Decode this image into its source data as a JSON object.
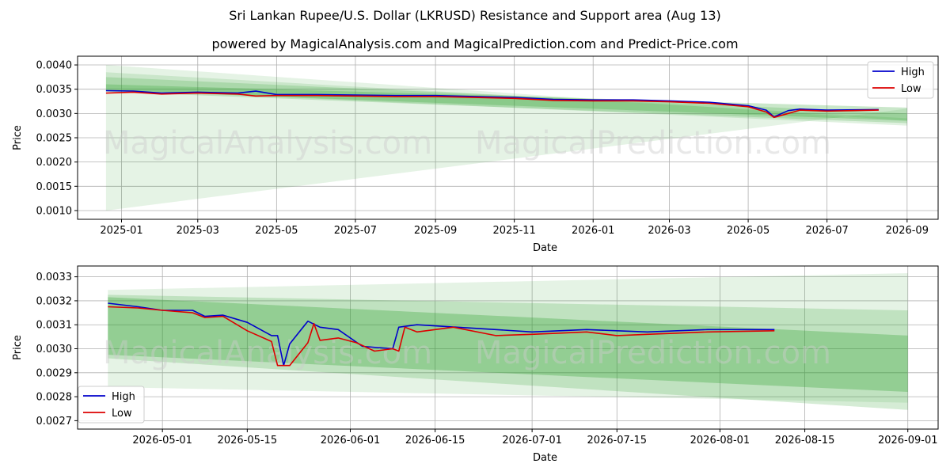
{
  "header": {
    "title": "Sri Lankan Rupee/U.S. Dollar (LKRUSD) Resistance and Support area (Aug 13)",
    "subtitle": "powered by MagicalAnalysis.com and MagicalPrediction.com and Predict-Price.com"
  },
  "watermarks": [
    "MagicalAnalysis.com",
    "MagicalPrediction.com"
  ],
  "colors": {
    "high": "#0000cc",
    "low": "#dd0000",
    "band": "#2ca02c"
  },
  "chart_data": [
    {
      "type": "line",
      "xlabel": "Date",
      "ylabel": "Price",
      "x_ticks": [
        "2025-01",
        "2025-03",
        "2025-05",
        "2025-07",
        "2025-09",
        "2025-11",
        "2026-01",
        "2026-03",
        "2026-05",
        "2026-07",
        "2026-09"
      ],
      "y_ticks": [
        "0.0010",
        "0.0015",
        "0.0020",
        "0.0025",
        "0.0030",
        "0.0035",
        "0.0040"
      ],
      "legend": [
        "High",
        "Low"
      ],
      "legend_position": "top-right",
      "grid": true,
      "series": [
        {
          "name": "High",
          "points": [
            [
              "2024-12-20",
              0.00347
            ],
            [
              "2025-01-10",
              0.00346
            ],
            [
              "2025-02-01",
              0.00342
            ],
            [
              "2025-03-01",
              0.00344
            ],
            [
              "2025-04-01",
              0.00342
            ],
            [
              "2025-04-15",
              0.00346
            ],
            [
              "2025-05-01",
              0.00339
            ],
            [
              "2025-06-01",
              0.00339
            ],
            [
              "2025-07-01",
              0.00338
            ],
            [
              "2025-08-01",
              0.00337
            ],
            [
              "2025-09-01",
              0.00337
            ],
            [
              "2025-10-01",
              0.00335
            ],
            [
              "2025-11-01",
              0.00333
            ],
            [
              "2025-12-01",
              0.00329
            ],
            [
              "2026-01-01",
              0.00328
            ],
            [
              "2026-02-01",
              0.00328
            ],
            [
              "2026-03-01",
              0.00326
            ],
            [
              "2026-04-01",
              0.00323
            ],
            [
              "2026-05-01",
              0.00316
            ],
            [
              "2026-05-15",
              0.00307
            ],
            [
              "2026-05-21",
              0.00293
            ],
            [
              "2026-06-01",
              0.00306
            ],
            [
              "2026-06-10",
              0.00309
            ],
            [
              "2026-07-01",
              0.00307
            ],
            [
              "2026-08-10",
              0.00308
            ]
          ]
        },
        {
          "name": "Low",
          "points": [
            [
              "2024-12-20",
              0.00342
            ],
            [
              "2025-01-10",
              0.00344
            ],
            [
              "2025-02-01",
              0.0034
            ],
            [
              "2025-03-01",
              0.00342
            ],
            [
              "2025-04-01",
              0.0034
            ],
            [
              "2025-04-15",
              0.00336
            ],
            [
              "2025-05-01",
              0.00337
            ],
            [
              "2025-06-01",
              0.00337
            ],
            [
              "2025-07-01",
              0.00336
            ],
            [
              "2025-08-01",
              0.00335
            ],
            [
              "2025-09-01",
              0.00335
            ],
            [
              "2025-10-01",
              0.00333
            ],
            [
              "2025-11-01",
              0.00331
            ],
            [
              "2025-12-01",
              0.00327
            ],
            [
              "2026-01-01",
              0.00326
            ],
            [
              "2026-02-01",
              0.00326
            ],
            [
              "2026-03-01",
              0.00324
            ],
            [
              "2026-04-01",
              0.00321
            ],
            [
              "2026-05-01",
              0.00314
            ],
            [
              "2026-05-15",
              0.00303
            ],
            [
              "2026-05-21",
              0.00292
            ],
            [
              "2026-06-01",
              0.003
            ],
            [
              "2026-06-10",
              0.00307
            ],
            [
              "2026-07-01",
              0.00305
            ],
            [
              "2026-08-10",
              0.00307
            ]
          ]
        }
      ],
      "bands": [
        {
          "x": [
            "2024-12-20",
            "2026-09-01"
          ],
          "upper": [
            0.004,
            0.00285
          ],
          "lower": [
            0.001,
            0.0031
          ],
          "opacity": 0.12
        },
        {
          "x": [
            "2024-12-20",
            "2026-09-01"
          ],
          "upper": [
            0.00385,
            0.0029
          ],
          "lower": [
            0.0035,
            0.00275
          ],
          "opacity": 0.15
        },
        {
          "x": [
            "2024-12-20",
            "2026-09-01"
          ],
          "upper": [
            0.00375,
            0.003
          ],
          "lower": [
            0.00345,
            0.0028
          ],
          "opacity": 0.2
        },
        {
          "x": [
            "2024-12-20",
            "2026-09-01"
          ],
          "upper": [
            0.0036,
            0.00312
          ],
          "lower": [
            0.00348,
            0.00285
          ],
          "opacity": 0.25
        }
      ]
    },
    {
      "type": "line",
      "xlabel": "Date",
      "ylabel": "Price",
      "x_ticks": [
        "2026-05-01",
        "2026-05-15",
        "2026-06-01",
        "2026-06-15",
        "2026-07-01",
        "2026-07-15",
        "2026-08-01",
        "2026-08-15",
        "2026-09-01"
      ],
      "y_ticks": [
        "0.0027",
        "0.0028",
        "0.0029",
        "0.0030",
        "0.0031",
        "0.0032",
        "0.0033"
      ],
      "legend": [
        "High",
        "Low"
      ],
      "legend_position": "bottom-left",
      "grid": true,
      "series": [
        {
          "name": "High",
          "points": [
            [
              "2026-04-22",
              0.00319
            ],
            [
              "2026-04-27",
              0.003175
            ],
            [
              "2026-05-01",
              0.00316
            ],
            [
              "2026-05-06",
              0.00316
            ],
            [
              "2026-05-08",
              0.003135
            ],
            [
              "2026-05-11",
              0.00314
            ],
            [
              "2026-05-15",
              0.00311
            ],
            [
              "2026-05-19",
              0.003055
            ],
            [
              "2026-05-20",
              0.003055
            ],
            [
              "2026-05-21",
              0.00293
            ],
            [
              "2026-05-22",
              0.00302
            ],
            [
              "2026-05-25",
              0.003115
            ],
            [
              "2026-05-27",
              0.00309
            ],
            [
              "2026-05-30",
              0.00308
            ],
            [
              "2026-06-03",
              0.00301
            ],
            [
              "2026-06-08",
              0.003
            ],
            [
              "2026-06-09",
              0.00309
            ],
            [
              "2026-06-12",
              0.0031
            ],
            [
              "2026-06-25",
              0.00308
            ],
            [
              "2026-07-01",
              0.00307
            ],
            [
              "2026-07-10",
              0.00308
            ],
            [
              "2026-07-15",
              0.003075
            ],
            [
              "2026-07-20",
              0.00307
            ],
            [
              "2026-07-30",
              0.00308
            ],
            [
              "2026-08-10",
              0.00308
            ]
          ]
        },
        {
          "name": "Low",
          "points": [
            [
              "2026-04-22",
              0.003175
            ],
            [
              "2026-04-27",
              0.00317
            ],
            [
              "2026-05-01",
              0.00316
            ],
            [
              "2026-05-06",
              0.00315
            ],
            [
              "2026-05-08",
              0.00313
            ],
            [
              "2026-05-11",
              0.003135
            ],
            [
              "2026-05-15",
              0.003075
            ],
            [
              "2026-05-19",
              0.00303
            ],
            [
              "2026-05-20",
              0.00293
            ],
            [
              "2026-05-22",
              0.00293
            ],
            [
              "2026-05-25",
              0.003025
            ],
            [
              "2026-05-26",
              0.003105
            ],
            [
              "2026-05-27",
              0.003035
            ],
            [
              "2026-05-30",
              0.003045
            ],
            [
              "2026-06-02",
              0.003025
            ],
            [
              "2026-06-05",
              0.00299
            ],
            [
              "2026-06-08",
              0.003
            ],
            [
              "2026-06-09",
              0.00299
            ],
            [
              "2026-06-10",
              0.00309
            ],
            [
              "2026-06-12",
              0.00307
            ],
            [
              "2026-06-18",
              0.00309
            ],
            [
              "2026-06-25",
              0.003055
            ],
            [
              "2026-07-01",
              0.00306
            ],
            [
              "2026-07-10",
              0.00307
            ],
            [
              "2026-07-15",
              0.003055
            ],
            [
              "2026-07-20",
              0.00306
            ],
            [
              "2026-07-30",
              0.00307
            ],
            [
              "2026-08-10",
              0.003075
            ]
          ]
        }
      ],
      "bands": [
        {
          "x": [
            "2026-04-22",
            "2026-09-01"
          ],
          "upper": [
            0.003245,
            0.003315
          ],
          "lower": [
            0.00284,
            0.002775
          ],
          "opacity": 0.12
        },
        {
          "x": [
            "2026-04-22",
            "2026-09-01"
          ],
          "upper": [
            0.003225,
            0.00316
          ],
          "lower": [
            0.00296,
            0.002745
          ],
          "opacity": 0.2
        },
        {
          "x": [
            "2026-04-22",
            "2026-09-01"
          ],
          "upper": [
            0.003215,
            0.003055
          ],
          "lower": [
            0.002975,
            0.00282
          ],
          "opacity": 0.3
        }
      ]
    }
  ]
}
